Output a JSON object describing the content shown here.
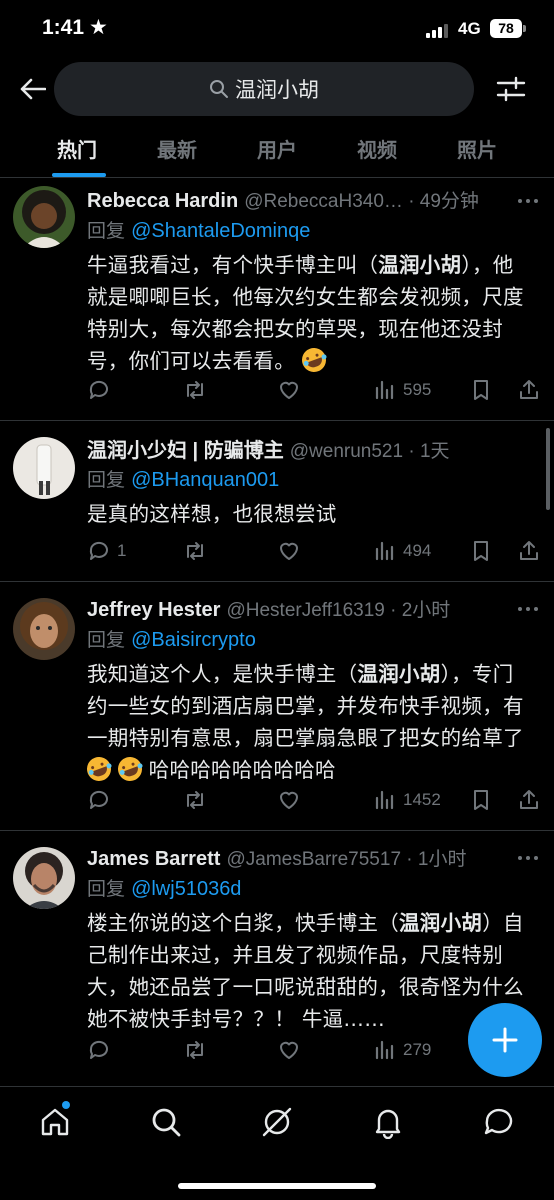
{
  "status_bar": {
    "time": "1:41",
    "network": "4G",
    "battery": "78"
  },
  "search": {
    "query": "温润小胡"
  },
  "tabs": [
    {
      "label": "热门",
      "active": true
    },
    {
      "label": "最新",
      "active": false
    },
    {
      "label": "用户",
      "active": false
    },
    {
      "label": "视频",
      "active": false
    },
    {
      "label": "照片",
      "active": false
    }
  ],
  "tweets": [
    {
      "name": "Rebecca Hardin",
      "meta": "@RebeccaH340… · 49分钟",
      "reply_prefix": "回复",
      "mention": "@ShantaleDominqe",
      "text_lines": [
        [
          "牛逼我看过，有个快手博主叫（",
          "温润小胡",
          "），他"
        ],
        [
          "就是唧唧巨长，他每次约女生都会发视频，尺度"
        ],
        [
          "特别大，每次都会把女的草哭，现在他还没封"
        ],
        [
          "号，你们可以去看看。"
        ]
      ],
      "replies": "",
      "retweets": "",
      "likes": "",
      "views": "595"
    },
    {
      "name": "温润小少妇 | 防骗博主",
      "meta": "@wenrun521 · 1天",
      "reply_prefix": "回复",
      "mention": "@BHanquan001",
      "text_lines": [
        [
          "是真的这样想，也很想尝试"
        ]
      ],
      "replies": "1",
      "retweets": "",
      "likes": "",
      "views": "494"
    },
    {
      "name": "Jeffrey Hester",
      "meta": "@HesterJeff16319 · 2小时",
      "reply_prefix": "回复",
      "mention": "@Baisircrypto",
      "text_lines": [
        [
          "我知道这个人，是快手博主（",
          "温润小胡",
          "），专门"
        ],
        [
          "约一些女的到酒店扇巴掌，并发布快手视频，有"
        ],
        [
          "一期特别有意思，扇巴掌扇急眼了把女的给草了"
        ],
        [
          "哈哈哈哈哈哈哈哈哈"
        ]
      ],
      "replies": "",
      "retweets": "",
      "likes": "",
      "views": "1452"
    },
    {
      "name": "James Barrett",
      "meta": "@JamesBarre75517 · 1小时",
      "reply_prefix": "回复",
      "mention": "@lwj51036d",
      "text_lines": [
        [
          "楼主你说的这个白浆，快手博主（",
          "温润小胡",
          "）自"
        ],
        [
          "己制作出来过，并且发了视频作品，尺度特别"
        ],
        [
          "大，她还品尝了一口呢说甜甜的，很奇怪为什么"
        ],
        [
          "她不被快手封号？？！ 牛逼……"
        ]
      ],
      "replies": "",
      "retweets": "",
      "likes": "",
      "views": "279"
    }
  ],
  "colors": {
    "accent": "#1d9bf0",
    "background": "#000000",
    "muted": "#71767b",
    "divider": "#2f3336"
  }
}
